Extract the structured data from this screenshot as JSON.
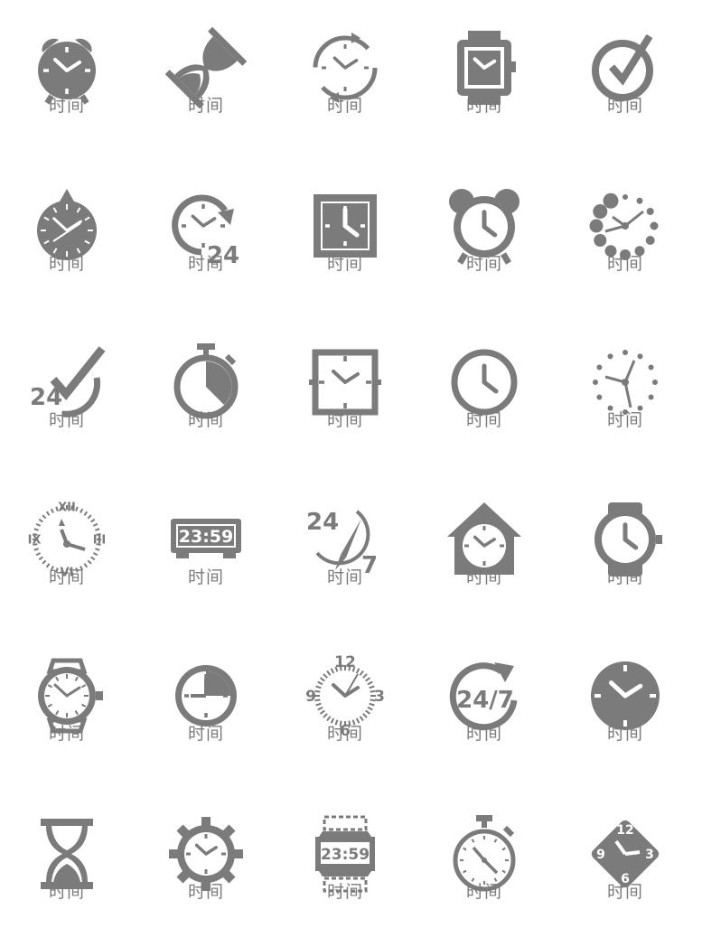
{
  "colors": {
    "icon": "#7b7b7b",
    "background": "#ffffff"
  },
  "icons": [
    {
      "name": "alarm-clock-icon",
      "label": "时间"
    },
    {
      "name": "hourglass-tilted-icon",
      "label": "时间"
    },
    {
      "name": "refresh-clock-icon",
      "label": "时间"
    },
    {
      "name": "square-wristwatch-icon",
      "label": "时间"
    },
    {
      "name": "clock-check-icon",
      "label": "时间"
    },
    {
      "name": "pocket-watch-icon",
      "label": "时间"
    },
    {
      "name": "clock-24-arrow-icon",
      "label": "时间",
      "text": "24"
    },
    {
      "name": "square-clock-icon",
      "label": "时间"
    },
    {
      "name": "alarm-clock-outline-icon",
      "label": "时间"
    },
    {
      "name": "dotted-clock-icon",
      "label": "时间"
    },
    {
      "name": "check-24-icon",
      "label": "时间",
      "text": "24"
    },
    {
      "name": "stopwatch-icon",
      "label": "时间"
    },
    {
      "name": "square-clock-outline-icon",
      "label": "时间"
    },
    {
      "name": "clock-outline-icon",
      "label": "时间"
    },
    {
      "name": "dotted-clock-small-icon",
      "label": "时间"
    },
    {
      "name": "roman-clock-icon",
      "label": "时间",
      "numerals": [
        "XII",
        "III",
        "VI",
        "IX"
      ]
    },
    {
      "name": "digital-clock-icon",
      "label": "时间",
      "text": "23:59"
    },
    {
      "name": "compass-24-7-icon",
      "label": "时间",
      "text": "24",
      "text2": "7"
    },
    {
      "name": "house-clock-icon",
      "label": "时间"
    },
    {
      "name": "round-wristwatch-icon",
      "label": "时间"
    },
    {
      "name": "dial-wristwatch-icon",
      "label": "时间"
    },
    {
      "name": "quarter-clock-icon",
      "label": "时间"
    },
    {
      "name": "numbered-clock-icon",
      "label": "时间",
      "numerals": [
        "12",
        "3",
        "6",
        "9"
      ]
    },
    {
      "name": "clock-24-7-icon",
      "label": "时间",
      "text": "24/7"
    },
    {
      "name": "filled-clock-icon",
      "label": "时间"
    },
    {
      "name": "hourglass-icon",
      "label": "时间"
    },
    {
      "name": "gear-clock-icon",
      "label": "时间"
    },
    {
      "name": "digital-watch-icon",
      "label": "时间",
      "text": "23:59"
    },
    {
      "name": "stopwatch-outline-icon",
      "label": "时间"
    },
    {
      "name": "diamond-clock-icon",
      "label": "时间",
      "numerals": [
        "12",
        "3",
        "6",
        "9"
      ]
    }
  ]
}
